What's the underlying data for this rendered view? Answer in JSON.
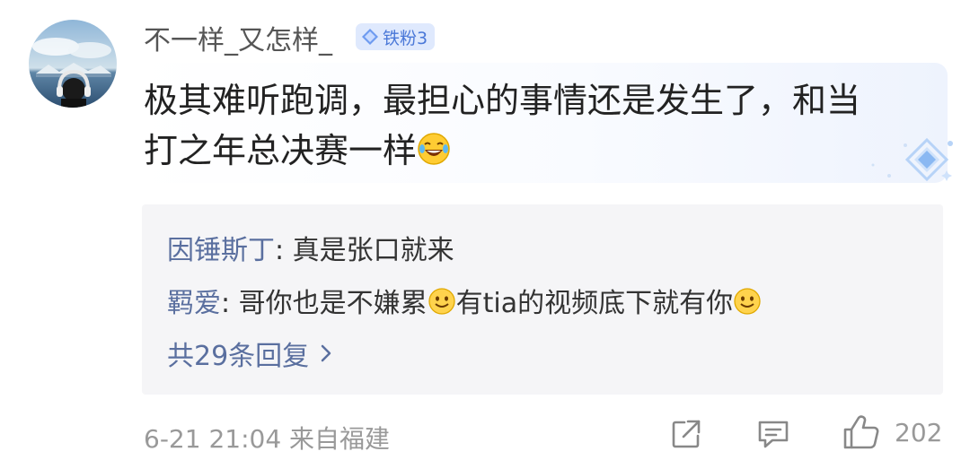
{
  "comment": {
    "author": "不一样_又怎样_",
    "badge": "铁粉3",
    "text_line1": "极其难听跑调，最担心的事情还是发生了，和当",
    "text_line2": "打之年总决赛一样",
    "emoji": "laugh-cry-emoji"
  },
  "replies": [
    {
      "name": "因锤斯丁",
      "separator": ": ",
      "text": "真是张口就来"
    },
    {
      "name": "羁爱",
      "separator": ": ",
      "text_a": "哥你也是不嫌累",
      "text_b": "有tia的视频底下就有你",
      "emoji": "smile-emoji"
    }
  ],
  "reply_summary": "共29条回复",
  "meta": {
    "date": "6-21 21:04",
    "location": "来自福建"
  },
  "actions": {
    "share_icon": "share-icon",
    "comment_icon": "comment-icon",
    "like_icon": "thumbs-up-icon",
    "like_count": "202"
  },
  "colors": {
    "link_blue": "#5a6f9f",
    "badge_blue": "#4a78d8",
    "muted": "#999999"
  }
}
